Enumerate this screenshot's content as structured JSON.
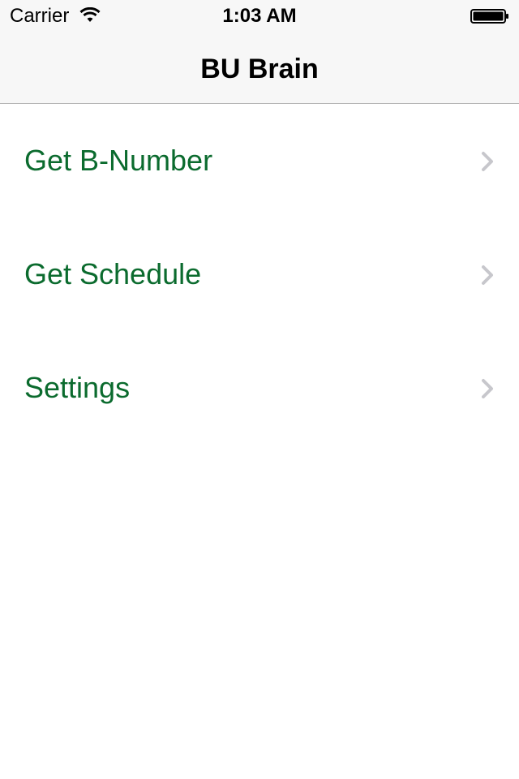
{
  "status_bar": {
    "carrier": "Carrier",
    "time": "1:03 AM"
  },
  "nav": {
    "title": "BU Brain"
  },
  "menu": {
    "items": [
      {
        "label": "Get B-Number",
        "icon": "chevron-right-icon"
      },
      {
        "label": "Get Schedule",
        "icon": "chevron-right-icon"
      },
      {
        "label": "Settings",
        "icon": "chevron-right-icon"
      }
    ]
  },
  "colors": {
    "accent": "#0b6b2e",
    "chevron": "#c7c7cc",
    "bar_background": "#f7f7f7"
  }
}
